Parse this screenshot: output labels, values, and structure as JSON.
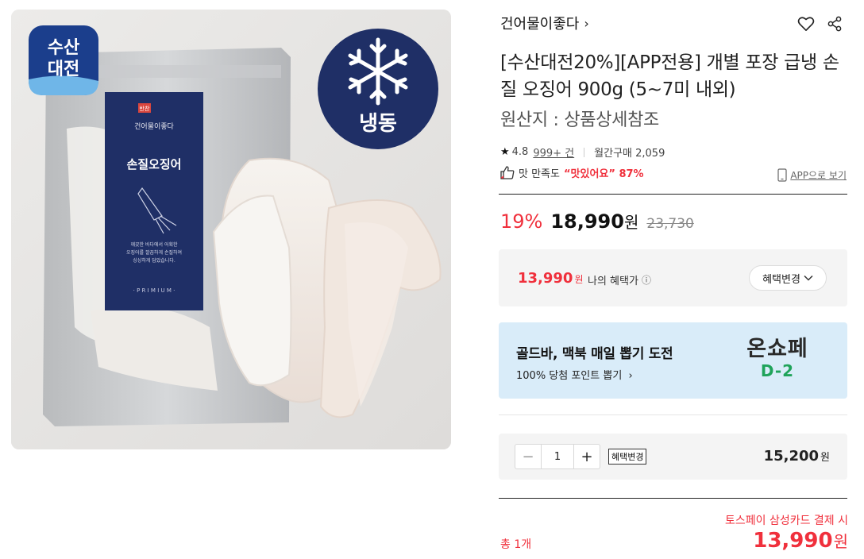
{
  "product_image": {
    "badge_left": {
      "line1": "수산",
      "line2": "대전"
    },
    "badge_frozen": "냉동",
    "label_brand": "건어물이좋다",
    "label_name": "손질오징어",
    "label_desc": [
      "깨끗한 바다에서 어획한",
      "오징어를 깔끔하게 손질하여",
      "싱싱하게 담았습니다."
    ],
    "label_premium": "· P R I M I U M ·",
    "label_tag": "반찬"
  },
  "brand": {
    "name": "건어물이좋다",
    "chevron": "›"
  },
  "icons": {
    "heart": "heart-icon",
    "share": "share-icon"
  },
  "title": "[수산대전20%][APP전용] 개별 포장 급냉 손질 오징어 900g (5~7미 내외)",
  "origin": "원산지 : 상품상세참조",
  "rating": {
    "star": "★",
    "score": "4.8",
    "reviews": "999+ 건",
    "monthly": "월간구매 2,059"
  },
  "satisfaction": {
    "prefix": "맛 만족도",
    "highlight": "“맛있어요” 87%"
  },
  "app_link": "APP으로 보기",
  "price": {
    "discount": "19%",
    "sale": "18,990",
    "won": "원",
    "original": "23,730"
  },
  "benefit": {
    "price": "13,990",
    "won": "원",
    "label": "나의 혜택가",
    "button": "혜택변경",
    "info_icon": "ⓘ"
  },
  "promo": {
    "title": "골드바, 맥북 매일 뽑기 도전",
    "sub": "100% 당첨 포인트 뽑기",
    "logo_line1": "온쇼페",
    "logo_line2": "D-2"
  },
  "quantity": {
    "minus": "−",
    "value": "1",
    "plus": "+",
    "badge": "혜택변경",
    "price": "15,200",
    "won": "원"
  },
  "payment": {
    "note": "토스페이 삼성카드 결제 시",
    "total_label": "총 1개",
    "total_price": "13,990",
    "won": "원"
  },
  "colors": {
    "accent_red": "#f0303c",
    "promo_bg": "#d9ecf9",
    "badge_navy": "#1f2f66",
    "logo_green": "#1fa35a"
  }
}
